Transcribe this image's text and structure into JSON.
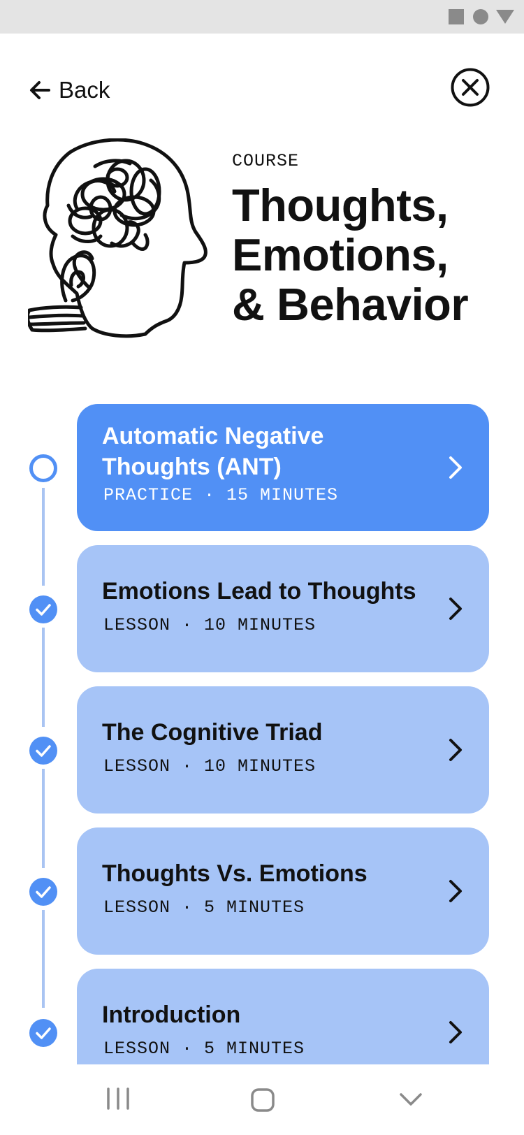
{
  "header": {
    "back_label": "Back"
  },
  "course": {
    "label": "COURSE",
    "title_lines": [
      "Thoughts,",
      "Emotions,",
      "& Behavior"
    ]
  },
  "lessons": [
    {
      "title": "Automatic Negative Thoughts (ANT)",
      "meta": "PRACTICE · 15 MINUTES",
      "status": "current"
    },
    {
      "title": "Emotions Lead to Thoughts",
      "meta": "LESSON · 10 MINUTES",
      "status": "completed"
    },
    {
      "title": "The Cognitive Triad",
      "meta": "LESSON · 10 MINUTES",
      "status": "completed"
    },
    {
      "title": "Thoughts Vs. Emotions",
      "meta": "LESSON · 5 MINUTES",
      "status": "completed"
    },
    {
      "title": "Introduction",
      "meta": "LESSON · 5 MINUTES",
      "status": "completed"
    }
  ],
  "icons": {
    "back": "arrow-left-icon",
    "close": "close-circle-icon",
    "chevron": "chevron-right-icon",
    "completed": "check-circle-icon",
    "current": "open-circle-icon",
    "illustration": "head-scribble-illustration",
    "nav_recents": "recents-icon",
    "nav_home": "home-icon",
    "nav_back": "nav-back-icon"
  },
  "colors": {
    "accent": "#5190f5",
    "card_inactive": "#a6c4f7",
    "timeline": "#a9c4f2",
    "text": "#111111"
  }
}
